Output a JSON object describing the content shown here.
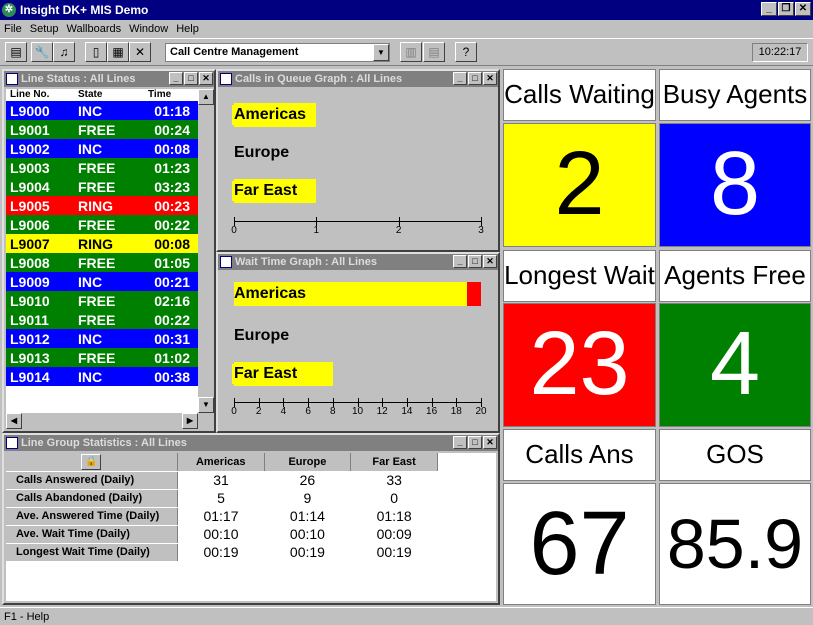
{
  "app": {
    "title": "Insight DK+ MIS Demo"
  },
  "menu": [
    "File",
    "Setup",
    "Wallboards",
    "Window",
    "Help"
  ],
  "toolbar": {
    "combo_value": "Call Centre Management",
    "clock": "10:22:17"
  },
  "line_status": {
    "title": "Line Status : All Lines",
    "headers": [
      "Line No.",
      "State",
      "Time"
    ],
    "rows": [
      {
        "line": "L9000",
        "state": "INC",
        "time": "01:18",
        "color": "#0000ff"
      },
      {
        "line": "L9001",
        "state": "FREE",
        "time": "00:24",
        "color": "#008000"
      },
      {
        "line": "L9002",
        "state": "INC",
        "time": "00:08",
        "color": "#0000ff"
      },
      {
        "line": "L9003",
        "state": "FREE",
        "time": "01:23",
        "color": "#008000"
      },
      {
        "line": "L9004",
        "state": "FREE",
        "time": "03:23",
        "color": "#008000"
      },
      {
        "line": "L9005",
        "state": "RING",
        "time": "00:23",
        "color": "#ff0000"
      },
      {
        "line": "L9006",
        "state": "FREE",
        "time": "00:22",
        "color": "#008000"
      },
      {
        "line": "L9007",
        "state": "RING",
        "time": "00:08",
        "color": "#ffff00"
      },
      {
        "line": "L9008",
        "state": "FREE",
        "time": "01:05",
        "color": "#008000"
      },
      {
        "line": "L9009",
        "state": "INC",
        "time": "00:21",
        "color": "#0000ff"
      },
      {
        "line": "L9010",
        "state": "FREE",
        "time": "02:16",
        "color": "#008000"
      },
      {
        "line": "L9011",
        "state": "FREE",
        "time": "00:22",
        "color": "#008000"
      },
      {
        "line": "L9012",
        "state": "INC",
        "time": "00:31",
        "color": "#0000ff"
      },
      {
        "line": "L9013",
        "state": "FREE",
        "time": "01:02",
        "color": "#008000"
      },
      {
        "line": "L9014",
        "state": "INC",
        "time": "00:38",
        "color": "#0000ff"
      }
    ]
  },
  "queue_graph": {
    "title": "Calls in Queue Graph : All Lines",
    "labels": [
      "Americas",
      "Europe",
      "Far East"
    ],
    "values": [
      1,
      0,
      1
    ],
    "max": 3,
    "ticks": [
      "0",
      "1",
      "2",
      "3"
    ]
  },
  "wait_graph": {
    "title": "Wait Time Graph : All Lines",
    "labels": [
      "Americas",
      "Europe",
      "Far East"
    ],
    "values": [
      23,
      0,
      8
    ],
    "max": 20,
    "ticks": [
      "0",
      "2",
      "4",
      "6",
      "8",
      "10",
      "12",
      "14",
      "16",
      "18",
      "20"
    ]
  },
  "group_stats": {
    "title": "Line Group Statistics : All Lines",
    "columns": [
      "Americas",
      "Europe",
      "Far East"
    ],
    "rows": [
      {
        "label": "Calls Answered (Daily)",
        "values": [
          "31",
          "26",
          "33"
        ]
      },
      {
        "label": "Calls Abandoned (Daily)",
        "values": [
          "5",
          "9",
          "0"
        ]
      },
      {
        "label": "Ave. Answered Time (Daily)",
        "values": [
          "01:17",
          "01:14",
          "01:18"
        ]
      },
      {
        "label": "Ave. Wait Time (Daily)",
        "values": [
          "00:10",
          "00:10",
          "00:09"
        ]
      },
      {
        "label": "Longest Wait Time (Daily)",
        "values": [
          "00:19",
          "00:19",
          "00:19"
        ]
      }
    ]
  },
  "wallboard": {
    "tiles": [
      {
        "label": "Calls Waiting",
        "value": "2",
        "bg": "#ffff00",
        "fg": "#000000"
      },
      {
        "label": "Busy Agents",
        "value": "8",
        "bg": "#0000ff",
        "fg": "#ffffff"
      },
      {
        "label": "Longest Wait",
        "value": "23",
        "bg": "#ff0000",
        "fg": "#ffffff"
      },
      {
        "label": "Agents Free",
        "value": "4",
        "bg": "#008000",
        "fg": "#ffffff"
      },
      {
        "label": "Calls Ans",
        "value": "67",
        "bg": "#ffffff",
        "fg": "#000000"
      },
      {
        "label": "GOS",
        "value": "85.9",
        "bg": "#ffffff",
        "fg": "#000000"
      }
    ]
  },
  "status_bar": {
    "text": "F1 - Help"
  }
}
